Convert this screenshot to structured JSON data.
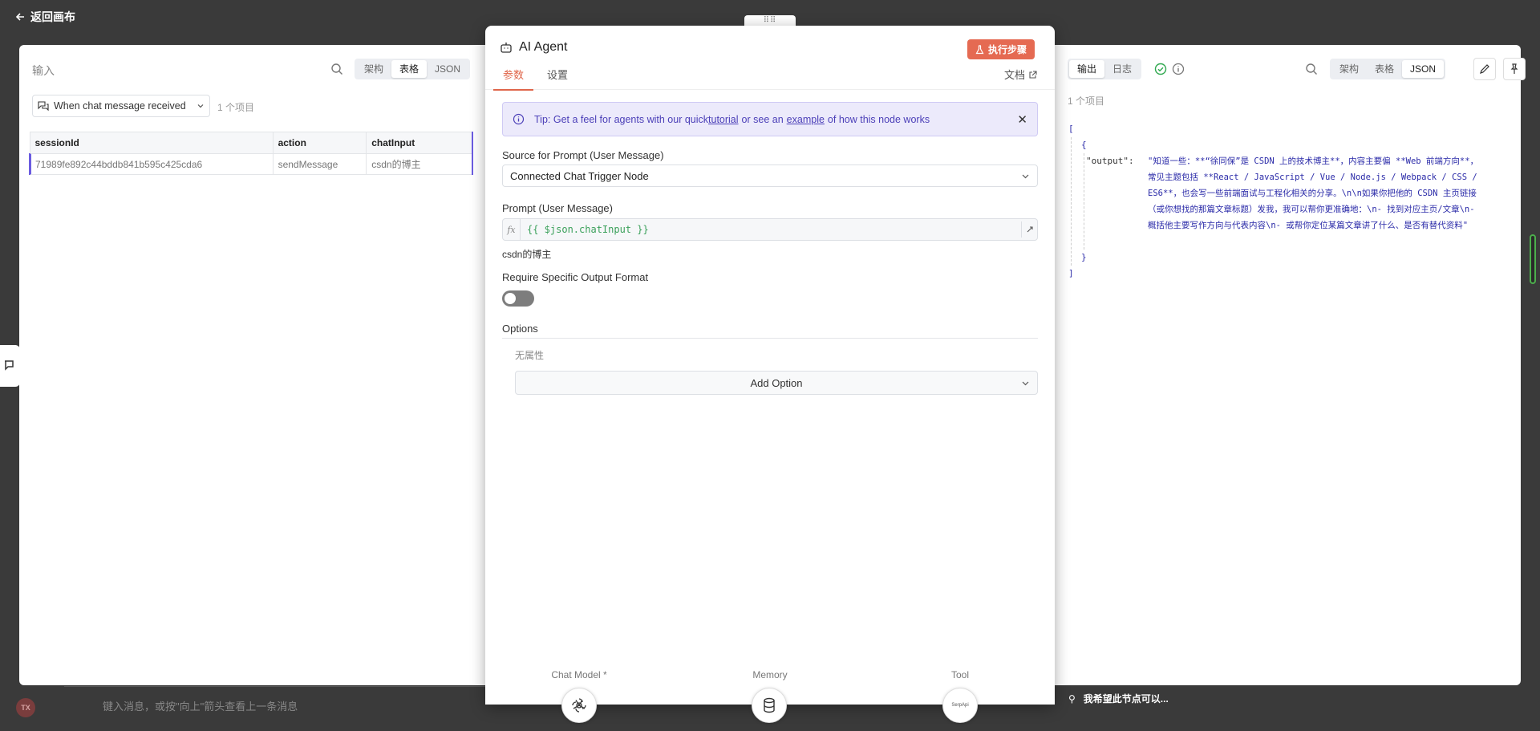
{
  "canvas": {
    "back_label": "返回画布",
    "chat_input_placeholder": "键入消息，或按\"向上\"箭头查看上一条消息",
    "avatar_initials": "TX",
    "feedback_text": "我希望此节点可以..."
  },
  "input_panel": {
    "title": "输入",
    "view_tabs": [
      "架构",
      "表格",
      "JSON"
    ],
    "active_view": "表格",
    "source_node": "When chat message received",
    "item_count": "1 个项目",
    "table": {
      "columns": [
        "sessionId",
        "action",
        "chatInput"
      ],
      "rows": [
        [
          "71989fe892c44bddb841b595c425cda6",
          "sendMessage",
          "csdn的博主"
        ]
      ]
    }
  },
  "node": {
    "title": "AI Agent",
    "execute_button": "执行步骤",
    "tabs": [
      "参数",
      "设置"
    ],
    "active_tab": "参数",
    "docs_link": "文档",
    "tip": {
      "prefix": "Tip: Get a feel for agents with our quick ",
      "link1": "tutorial",
      "middle": " or see an ",
      "link2": "example",
      "suffix": " of how this node works"
    },
    "source_label": "Source for Prompt (User Message)",
    "source_value": "Connected Chat Trigger Node",
    "prompt_label": "Prompt (User Message)",
    "prompt_fx": "fx",
    "prompt_expression": "{{ $json.chatInput }}",
    "prompt_preview": "csdn的博主",
    "require_format_label": "Require Specific Output Format",
    "require_format_on": false,
    "options_label": "Options",
    "no_properties": "无属性",
    "add_option_label": "Add Option",
    "subnodes": [
      {
        "label": "Chat Model *",
        "icon": "openai-icon"
      },
      {
        "label": "Memory",
        "icon": "database-icon"
      },
      {
        "label": "Tool",
        "icon": "serpapi-icon",
        "icon_text": "SerpApi"
      }
    ]
  },
  "output_panel": {
    "tabs": [
      "输出",
      "日志"
    ],
    "active_tab": "输出",
    "view_tabs": [
      "架构",
      "表格",
      "JSON"
    ],
    "active_view": "JSON",
    "item_count": "1 个项目",
    "json_open_bracket": "[",
    "json_open_brace": "{",
    "json_key": "\"output\":",
    "json_value_lines": [
      "\"知道一些：**“徐同保”是 CSDN 上的技术博主**，内容主要偏 **Web 前端方向**，",
      "常见主题包括 **React / JavaScript / Vue / Node.js / Webpack / CSS /",
      "ES6**，也会写一些前端面试与工程化相关的分享。\\n\\n如果你把他的 CSDN 主页链接",
      "（或你想找的那篇文章标题）发我，我可以帮你更准确地：\\n- 找到对应主页/文章\\n-",
      "概括他主要写作方向与代表内容\\n- 或帮你定位某篇文章讲了什么、是否有替代资料\""
    ],
    "json_close_brace": "}",
    "json_close_bracket": "]"
  },
  "colors": {
    "accent": "#e0664a",
    "execute_bg": "#e56a52",
    "tip_bg": "#eceafb",
    "tip_border": "#cfcaf4",
    "link": "#4b3fb8",
    "expr_green": "#3aa05a",
    "json_blue": "#2a2aa8",
    "success_green": "#2fa84f"
  }
}
